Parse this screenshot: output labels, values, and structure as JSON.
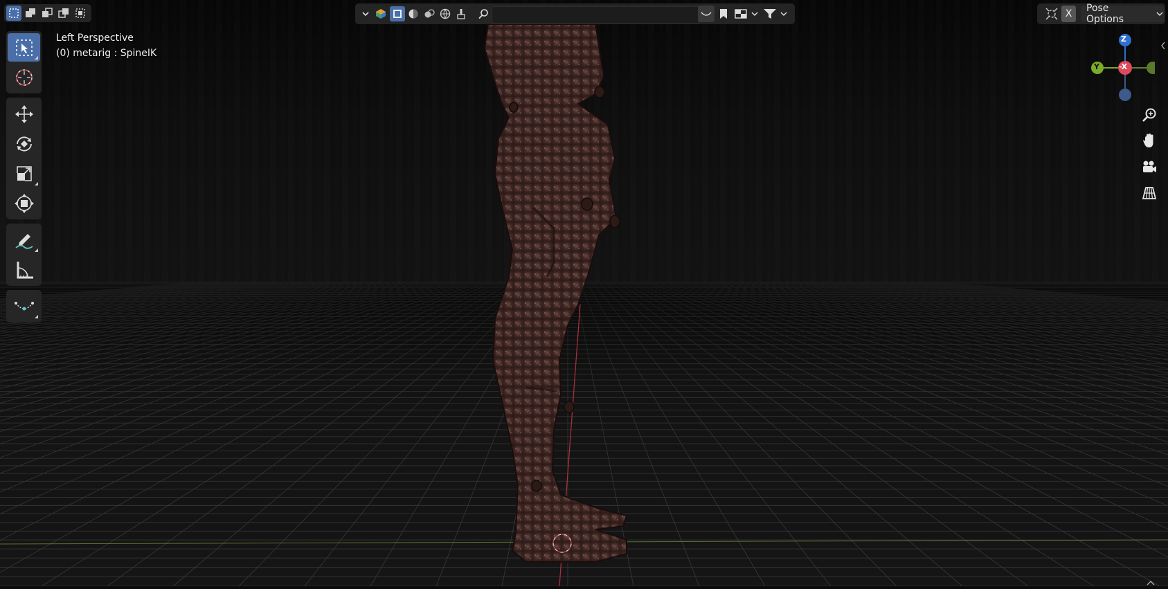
{
  "header": {
    "select_modes": [
      "select-box-new-icon",
      "select-box-extend-icon",
      "select-box-subtract-icon",
      "select-box-invert-icon",
      "select-box-intersect-icon"
    ],
    "center_controls": [
      "dropdown-chevron-icon",
      "object-type-visibility-icon",
      "selectability-icon",
      "solid-shading-icon",
      "material-shading-icon",
      "rendered-shading-icon",
      "paint-icon"
    ],
    "search": {
      "value": ""
    },
    "filter_controls": [
      "curve-icon",
      "bookmark-icon",
      "layout-icon",
      "filter-icon"
    ],
    "right_controls": [
      "gizmo-icon"
    ],
    "close_label": "X",
    "pose_options_label": "Pose Options"
  },
  "viewport": {
    "view_name": "Left Perspective",
    "object_info": "(0) metarig : SpineIK"
  },
  "toolbar": {
    "groups": [
      [
        "select-tool",
        "cursor-tool"
      ],
      [
        "move-tool",
        "rotate-tool",
        "scale-tool",
        "transform-tool"
      ],
      [
        "annotate-tool",
        "measure-tool"
      ],
      [
        "pose-bend-tool"
      ]
    ],
    "active_tool": "select-tool"
  },
  "navigation_gizmo": {
    "axes": {
      "z": "Z",
      "y": "Y",
      "x": "-X"
    },
    "colors": {
      "x": "#e0485c",
      "y": "#7aab2a",
      "z": "#2f6fd0"
    }
  },
  "nav_buttons": [
    "zoom-icon",
    "pan-hand-icon",
    "camera-icon",
    "perspective-grid-icon"
  ],
  "colors": {
    "accent": "#4a6fa8",
    "background": "#0b0b0b",
    "grid": "#3a3a3a"
  }
}
